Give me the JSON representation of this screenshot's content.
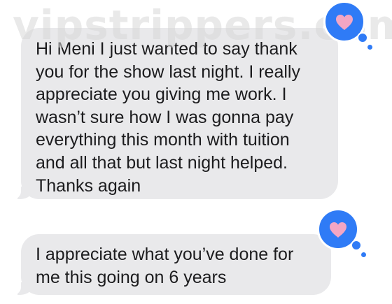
{
  "watermark": {
    "text": "vipstrippers.com"
  },
  "messages": [
    {
      "text": "Hi Meni I just wanted to say thank\nyou for the show last night. I really\nappreciate you giving me work. I\nwasn’t sure how I was gonna pay\neverything this month with tuition\nand all that but last night helped.\nThanks again",
      "reaction": "heart-icon"
    },
    {
      "text": "I appreciate what you’ve done for\nme this going on 6 years",
      "reaction": "heart-icon"
    }
  ],
  "colors": {
    "bubble_background": "#e9e9eb",
    "reaction_background": "#2f7bf6",
    "heart": "#f3a6c4",
    "text": "#1c1c1e"
  }
}
